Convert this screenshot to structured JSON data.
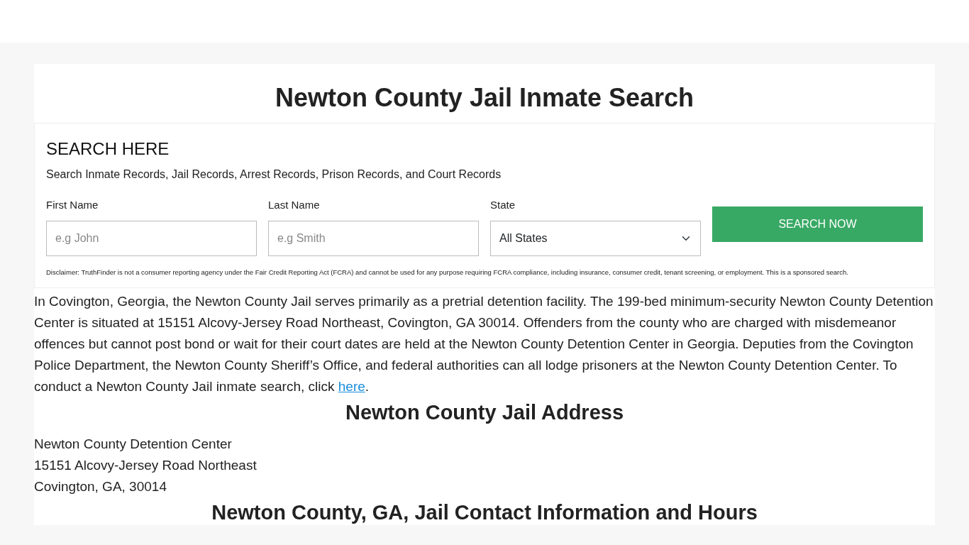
{
  "title": "Newton County Jail Inmate Search",
  "search": {
    "heading": "SEARCH HERE",
    "subtitle": "Search Inmate Records, Jail Records, Arrest Records, Prison Records, and Court Records",
    "fields": [
      {
        "kind": "text",
        "label": "First Name",
        "placeholder": "e.g John"
      },
      {
        "kind": "text",
        "label": "Last Name",
        "placeholder": "e.g Smith"
      },
      {
        "kind": "select",
        "label": "State",
        "value": "All States"
      }
    ],
    "button": "SEARCH NOW",
    "disclaimer": "Disclaimer: TruthFinder is not a consumer reporting agency under the Fair Credit Reporting Act (FCRA) and cannot be used for any purpose requiring FCRA compliance, including insurance, consumer credit, tenant screening, or employment. This is a sponsored search."
  },
  "intro": {
    "text": "In Covington, Georgia, the Newton County Jail serves primarily as a pretrial detention facility. The 199-bed minimum-security Newton County Detention Center is situated at 15151 Alcovy-Jersey Road Northeast, Covington, GA 30014. Offenders from the county who are charged with misdemeanor offences but cannot post bond or wait for their court dates are held at the Newton County Detention Center in Georgia. Deputies from the Covington Police Department, the Newton County Sheriff’s Office, and federal authorities can all lodge prisoners at the Newton County Detention Center. To conduct a Newton County Jail inmate search, click ",
    "link": "here",
    "after": "."
  },
  "address": {
    "heading": "Newton County Jail Address",
    "lines": [
      "Newton County Detention Center",
      "15151 Alcovy-Jersey Road Northeast",
      "Covington, GA, 30014"
    ]
  },
  "contact": {
    "heading": "Newton County, GA, Jail Contact Information and Hours"
  }
}
